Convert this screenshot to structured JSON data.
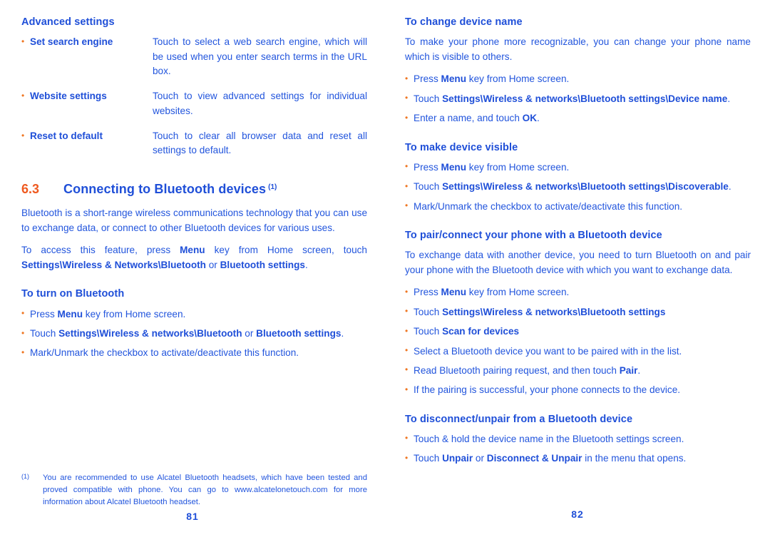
{
  "document": {
    "accent_blue": "#1f4fd8",
    "body_blue": "#2255dd",
    "bullet_orange": "#ef7622",
    "section_number_orange": "#ef5a20"
  },
  "left_page": {
    "page_number": "81",
    "advanced_settings": {
      "heading": "Advanced settings",
      "rows": [
        {
          "term": "Set search engine",
          "description": "Touch to select a web search engine, which will be used when you enter search terms in the URL box."
        },
        {
          "term": "Website settings",
          "description": "Touch to view advanced settings for individual websites."
        },
        {
          "term": "Reset to default",
          "description": "Touch to clear all browser data and reset all settings to default."
        }
      ]
    },
    "section": {
      "number": "6.3",
      "title": "Connecting to Bluetooth devices",
      "superscript": "(1)",
      "intro_paragraph": "Bluetooth is a short-range wireless communications technology that you can use to exchange data, or connect to other Bluetooth devices for various uses.",
      "access_paragraph": {
        "p1": "To access this feature, press ",
        "b1": "Menu",
        "p2": " key from Home screen, touch ",
        "b2": "Settings\\Wireless & Networks\\Bluetooth",
        "p3": " or ",
        "b3": "Bluetooth settings",
        "p4": "."
      }
    },
    "turn_on_bluetooth": {
      "heading": "To turn on Bluetooth",
      "items": [
        {
          "p1": "Press ",
          "b1": "Menu",
          "p2": " key from Home screen.",
          "b2": "",
          "p3": ""
        },
        {
          "p1": "Touch ",
          "b1": "Settings\\Wireless & networks\\Bluetooth",
          "p2": " or ",
          "b2": "Bluetooth settings",
          "p3": "."
        },
        {
          "p1": "Mark/Unmark the checkbox to activate/deactivate this function.",
          "b1": "",
          "p2": "",
          "b2": "",
          "p3": ""
        }
      ]
    },
    "footnote": {
      "marker": "(1)",
      "text": "You are recommended to use Alcatel Bluetooth headsets, which have been tested and proved compatible with phone. You can go to www.alcatelonetouch.com for more information about Alcatel Bluetooth headset."
    }
  },
  "right_page": {
    "page_number": "82",
    "change_device_name": {
      "heading": "To change device name",
      "paragraph": "To make your phone more recognizable, you can change your phone name which is visible to others.",
      "items": [
        {
          "p1": "Press ",
          "b1": "Menu",
          "p2": " key from Home screen.",
          "b2": "",
          "p3": ""
        },
        {
          "p1": "Touch ",
          "b1": "Settings\\Wireless & networks\\Bluetooth settings\\Device name",
          "p2": ".",
          "b2": "",
          "p3": ""
        },
        {
          "p1": "Enter a name, and touch ",
          "b1": "OK",
          "p2": ".",
          "b2": "",
          "p3": ""
        }
      ]
    },
    "make_device_visible": {
      "heading": "To make device visible",
      "items": [
        {
          "p1": "Press ",
          "b1": "Menu",
          "p2": " key from Home screen.",
          "b2": "",
          "p3": ""
        },
        {
          "p1": "Touch ",
          "b1": "Settings\\Wireless & networks\\Bluetooth settings\\Discoverable",
          "p2": ".",
          "b2": "",
          "p3": ""
        },
        {
          "p1": "Mark/Unmark the checkbox to activate/deactivate this function.",
          "b1": "",
          "p2": "",
          "b2": "",
          "p3": ""
        }
      ]
    },
    "pair_connect": {
      "heading": "To pair/connect your phone with a Bluetooth device",
      "paragraph": "To exchange data with another device, you need to turn Bluetooth on and pair your phone with the Bluetooth device with which you want to exchange data.",
      "items": [
        {
          "p1": "Press ",
          "b1": "Menu",
          "p2": " key from Home screen.",
          "b2": "",
          "p3": ""
        },
        {
          "p1": "Touch ",
          "b1": "Settings\\Wireless & networks\\Bluetooth settings",
          "p2": "",
          "b2": "",
          "p3": ""
        },
        {
          "p1": "Touch ",
          "b1": "Scan for devices",
          "p2": "",
          "b2": "",
          "p3": ""
        },
        {
          "p1": "Select a Bluetooth device you want to be paired with in the list.",
          "b1": "",
          "p2": "",
          "b2": "",
          "p3": ""
        },
        {
          "p1": "Read Bluetooth pairing request, and then touch ",
          "b1": "Pair",
          "p2": ".",
          "b2": "",
          "p3": ""
        },
        {
          "p1": "If the pairing is successful, your phone connects to the device.",
          "b1": "",
          "p2": "",
          "b2": "",
          "p3": ""
        }
      ]
    },
    "disconnect_unpair": {
      "heading": "To disconnect/unpair from a Bluetooth device",
      "items": [
        {
          "p1": "Touch & hold the device name in the Bluetooth settings screen.",
          "b1": "",
          "p2": "",
          "b2": "",
          "p3": ""
        },
        {
          "p1": "Touch ",
          "b1": "Unpair",
          "p2": " or ",
          "b2": "Disconnect & Unpair",
          "p3": " in the menu that opens."
        }
      ]
    }
  }
}
